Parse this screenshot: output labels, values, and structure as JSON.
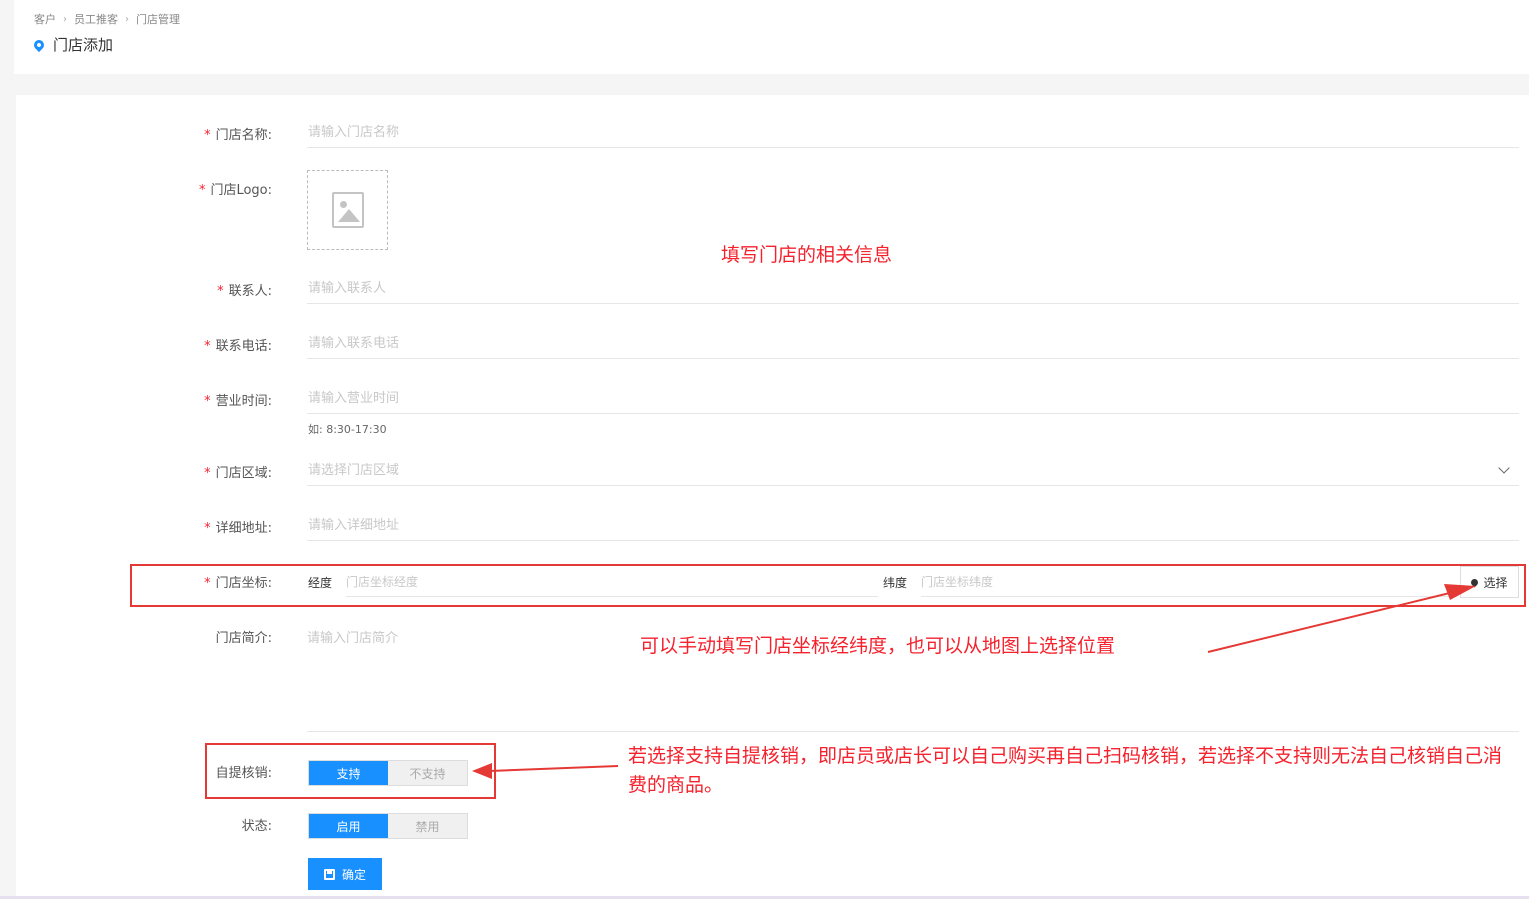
{
  "breadcrumb": [
    "客户",
    "员工推客",
    "门店管理"
  ],
  "page_title": "门店添加",
  "form": {
    "store_name": {
      "label": "门店名称:",
      "placeholder": "请输入门店名称",
      "required": true
    },
    "store_logo": {
      "label": "门店Logo:",
      "required": true
    },
    "contact": {
      "label": "联系人:",
      "placeholder": "请输入联系人",
      "required": true
    },
    "phone": {
      "label": "联系电话:",
      "placeholder": "请输入联系电话",
      "required": true
    },
    "hours": {
      "label": "营业时间:",
      "placeholder": "请输入营业时间",
      "hint": "如: 8:30-17:30",
      "required": true
    },
    "region": {
      "label": "门店区域:",
      "placeholder": "请选择门店区域",
      "required": true
    },
    "address": {
      "label": "详细地址:",
      "placeholder": "请输入详细地址",
      "required": true
    },
    "coords": {
      "label": "门店坐标:",
      "required": true,
      "lng_label": "经度",
      "lng_placeholder": "门店坐标经度",
      "lat_label": "纬度",
      "lat_placeholder": "门店坐标纬度",
      "pick_label": "选择"
    },
    "intro": {
      "label": "门店简介:",
      "placeholder": "请输入门店简介",
      "required": false
    },
    "self_verify": {
      "label": "自提核销:",
      "options": [
        "支持",
        "不支持"
      ],
      "selected": "支持"
    },
    "status": {
      "label": "状态:",
      "options": [
        "启用",
        "禁用"
      ],
      "selected": "启用"
    },
    "confirm_label": "确定"
  },
  "annotations": {
    "store_info": "填写门店的相关信息",
    "coords": "可以手动填写门店坐标经纬度，也可以从地图上选择位置",
    "self_verify": "若选择支持自提核销，即店员或店长可以自己购买再自己扫码核销，若选择不支持则无法自己核销自己消费的商品。"
  },
  "colors": {
    "primary": "#1890ff",
    "required_star": "#f5222d",
    "annotation": "#e53935"
  },
  "icons": {
    "location": "map-pin-icon",
    "logo_placeholder": "image-placeholder-icon",
    "dropdown": "chevron-down-icon",
    "confirm": "save-icon"
  }
}
